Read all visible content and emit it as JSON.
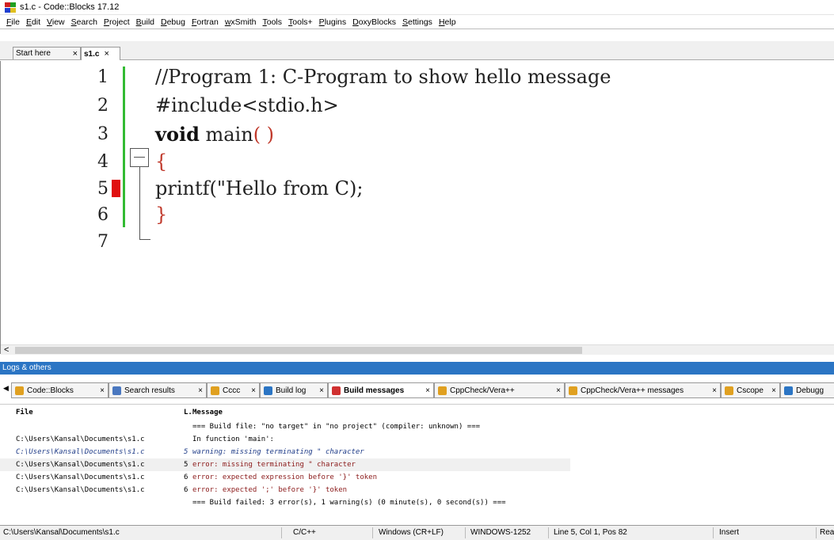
{
  "window": {
    "title": "s1.c - Code::Blocks 17.12"
  },
  "menu": [
    "File",
    "Edit",
    "View",
    "Search",
    "Project",
    "Build",
    "Debug",
    "Fortran",
    "wxSmith",
    "Tools",
    "Tools+",
    "Plugins",
    "DoxyBlocks",
    "Settings",
    "Help"
  ],
  "editor_tabs": [
    {
      "label": "Start here",
      "close": "×"
    },
    {
      "label": "s1.c",
      "close": "×"
    }
  ],
  "code": {
    "line_numbers": [
      "1",
      "2",
      "3",
      "4",
      "5",
      "6",
      "7"
    ],
    "line1": "//Program 1: C-Program to show hello message",
    "line2": "#include<stdio.h>",
    "line3_kw": "void",
    "line3_rest": " main",
    "line3_parens": "( )",
    "line4": "{",
    "line5": "printf(\"Hello from C);",
    "line6": "}"
  },
  "scroll_left_arrow": "<",
  "logs": {
    "title": "Logs & others",
    "tab_scroll": "◀",
    "tabs": [
      {
        "label": "Code::Blocks",
        "close": "×",
        "icon_color": "#e0a020"
      },
      {
        "label": "Search results",
        "close": "×",
        "icon_color": "#4a78c0"
      },
      {
        "label": "Cccc",
        "close": "×",
        "icon_color": "#e0a020"
      },
      {
        "label": "Build log",
        "close": "×",
        "icon_color": "#2b75c4"
      },
      {
        "label": "Build messages",
        "close": "×",
        "icon_color": "#d03030"
      },
      {
        "label": "CppCheck/Vera++",
        "close": "×",
        "icon_color": "#e0a020"
      },
      {
        "label": "CppCheck/Vera++ messages",
        "close": "×",
        "icon_color": "#e0a020"
      },
      {
        "label": "Cscope",
        "close": "×",
        "icon_color": "#e0a020"
      },
      {
        "label": "Debugg",
        "close": "",
        "icon_color": "#2b75c4"
      }
    ],
    "headers": {
      "file": "File",
      "line": "L.",
      "message": "Message"
    },
    "rows": [
      {
        "file": "",
        "line": "",
        "message": "=== Build file: \"no target\" in \"no project\" (compiler: unknown) ===",
        "kind": "info"
      },
      {
        "file": "C:\\Users\\Kansal\\Documents\\s1.c",
        "line": "",
        "message": "In function 'main':",
        "kind": "info"
      },
      {
        "file": "C:\\Users\\Kansal\\Documents\\s1.c",
        "line": "5",
        "message": "warning: missing terminating \" character",
        "kind": "warn"
      },
      {
        "file": "C:\\Users\\Kansal\\Documents\\s1.c",
        "line": "5",
        "message": "error: missing terminating \" character",
        "kind": "err"
      },
      {
        "file": "C:\\Users\\Kansal\\Documents\\s1.c",
        "line": "6",
        "message": "error: expected expression before '}' token",
        "kind": "err"
      },
      {
        "file": "C:\\Users\\Kansal\\Documents\\s1.c",
        "line": "6",
        "message": "error: expected ';' before '}' token",
        "kind": "err"
      },
      {
        "file": "",
        "line": "",
        "message": "=== Build failed: 3 error(s), 1 warning(s) (0 minute(s), 0 second(s)) ===",
        "kind": "info"
      }
    ]
  },
  "status": {
    "path": "C:\\Users\\Kansal\\Documents\\s1.c",
    "language": "C/C++",
    "eol": "Windows (CR+LF)",
    "encoding": "WINDOWS-1252",
    "position": "Line 5, Col 1, Pos 82",
    "mode": "Insert",
    "rw": "Rea"
  },
  "colors": {
    "accent": "#2b75c4",
    "change_bar": "#33bb33",
    "error_marker": "#e01010"
  }
}
